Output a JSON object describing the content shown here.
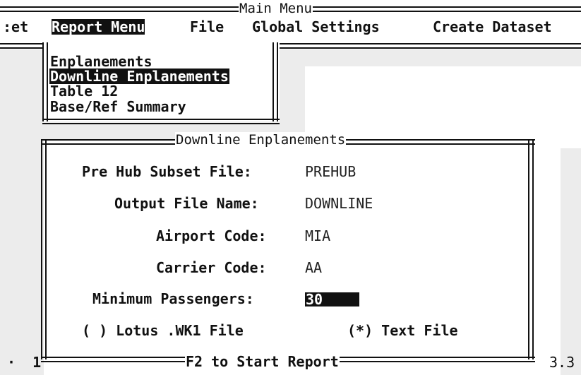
{
  "menubar": {
    "title": "Main Menu",
    "items": [
      {
        "label": ":et"
      },
      {
        "label": "Report Menu"
      },
      {
        "label": "File"
      },
      {
        "label": "Global Settings"
      },
      {
        "label": "Create Dataset"
      }
    ]
  },
  "dropdown": {
    "items": [
      {
        "label": "Enplanements"
      },
      {
        "label": "Downline Enplanements"
      },
      {
        "label": "Table 12"
      },
      {
        "label": "Base/Ref Summary"
      }
    ]
  },
  "dialog": {
    "title": "Downline Enplanements",
    "fields": {
      "prehub": {
        "label": "Pre Hub Subset File:",
        "value": "PREHUB"
      },
      "output": {
        "label": "Output File Name:",
        "value": "DOWNLINE"
      },
      "airport": {
        "label": "Airport Code:",
        "value": "MIA"
      },
      "carrier": {
        "label": "Carrier Code:",
        "value": "AA"
      },
      "minpass": {
        "label": "Minimum Passengers:",
        "value": "30"
      }
    },
    "options": {
      "lotus": {
        "marker": "( )",
        "label": "Lotus .WK1 File"
      },
      "text": {
        "marker": "(*)",
        "label": "Text File"
      }
    },
    "footer": "F2 to Start Report"
  },
  "background": {
    "left_text": "·  1",
    "right_text": "3.3"
  }
}
